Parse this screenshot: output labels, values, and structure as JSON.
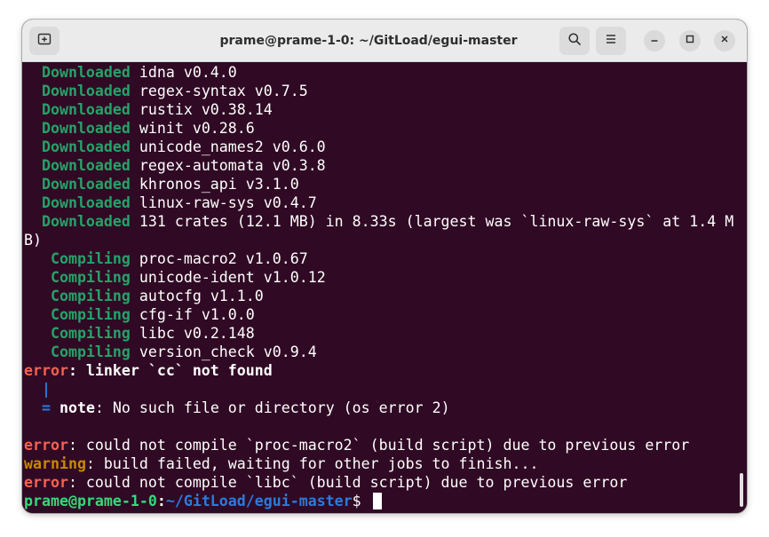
{
  "window": {
    "title": "prame@prame-1-0: ~/GitLoad/egui-master"
  },
  "icons": {
    "new_tab": "new-tab-icon",
    "search": "search-icon",
    "menu": "hamburger-menu-icon",
    "minimize": "minimize-icon",
    "maximize": "maximize-icon",
    "close": "close-icon"
  },
  "colors": {
    "terminal_bg": "#300a24",
    "green": "#26a269",
    "red": "#f66151",
    "yellow": "#c88800",
    "blue": "#2a7bde"
  },
  "terminal": {
    "lines": [
      {
        "parts": [
          {
            "t": "  "
          },
          {
            "t": "Downloaded",
            "c": "g"
          },
          {
            "t": " idna v0.4.0"
          }
        ]
      },
      {
        "parts": [
          {
            "t": "  "
          },
          {
            "t": "Downloaded",
            "c": "g"
          },
          {
            "t": " regex-syntax v0.7.5"
          }
        ]
      },
      {
        "parts": [
          {
            "t": "  "
          },
          {
            "t": "Downloaded",
            "c": "g"
          },
          {
            "t": " rustix v0.38.14"
          }
        ]
      },
      {
        "parts": [
          {
            "t": "  "
          },
          {
            "t": "Downloaded",
            "c": "g"
          },
          {
            "t": " winit v0.28.6"
          }
        ]
      },
      {
        "parts": [
          {
            "t": "  "
          },
          {
            "t": "Downloaded",
            "c": "g"
          },
          {
            "t": " unicode_names2 v0.6.0"
          }
        ]
      },
      {
        "parts": [
          {
            "t": "  "
          },
          {
            "t": "Downloaded",
            "c": "g"
          },
          {
            "t": " regex-automata v0.3.8"
          }
        ]
      },
      {
        "parts": [
          {
            "t": "  "
          },
          {
            "t": "Downloaded",
            "c": "g"
          },
          {
            "t": " khronos_api v3.1.0"
          }
        ]
      },
      {
        "parts": [
          {
            "t": "  "
          },
          {
            "t": "Downloaded",
            "c": "g"
          },
          {
            "t": " linux-raw-sys v0.4.7"
          }
        ]
      },
      {
        "parts": [
          {
            "t": "  "
          },
          {
            "t": "Downloaded",
            "c": "g"
          },
          {
            "t": " 131 crates (12.1 MB) in 8.33s (largest was `linux-raw-sys` at 1.4 M"
          }
        ]
      },
      {
        "parts": [
          {
            "t": "B)"
          }
        ]
      },
      {
        "parts": [
          {
            "t": "   "
          },
          {
            "t": "Compiling",
            "c": "g"
          },
          {
            "t": " proc-macro2 v1.0.67"
          }
        ]
      },
      {
        "parts": [
          {
            "t": "   "
          },
          {
            "t": "Compiling",
            "c": "g"
          },
          {
            "t": " unicode-ident v1.0.12"
          }
        ]
      },
      {
        "parts": [
          {
            "t": "   "
          },
          {
            "t": "Compiling",
            "c": "g"
          },
          {
            "t": " autocfg v1.1.0"
          }
        ]
      },
      {
        "parts": [
          {
            "t": "   "
          },
          {
            "t": "Compiling",
            "c": "g"
          },
          {
            "t": " cfg-if v1.0.0"
          }
        ]
      },
      {
        "parts": [
          {
            "t": "   "
          },
          {
            "t": "Compiling",
            "c": "g"
          },
          {
            "t": " libc v0.2.148"
          }
        ]
      },
      {
        "parts": [
          {
            "t": "   "
          },
          {
            "t": "Compiling",
            "c": "g"
          },
          {
            "t": " version_check v0.9.4"
          }
        ]
      },
      {
        "parts": [
          {
            "t": "error",
            "c": "r"
          },
          {
            "t": ": linker `cc` not found",
            "c": "w"
          }
        ]
      },
      {
        "parts": [
          {
            "t": "  "
          },
          {
            "t": "|",
            "c": "b"
          }
        ]
      },
      {
        "parts": [
          {
            "t": "  "
          },
          {
            "t": "=",
            "c": "b"
          },
          {
            "t": " "
          },
          {
            "t": "note",
            "c": "w"
          },
          {
            "t": ": No such file or directory (os error 2)"
          }
        ]
      },
      {
        "parts": []
      },
      {
        "parts": [
          {
            "t": "error",
            "c": "r"
          },
          {
            "t": ": could not compile `proc-macro2` (build script) due to previous error"
          }
        ]
      },
      {
        "parts": [
          {
            "t": "warning",
            "c": "y"
          },
          {
            "t": ": build failed, waiting for other jobs to finish..."
          }
        ]
      },
      {
        "parts": [
          {
            "t": "error",
            "c": "r"
          },
          {
            "t": ": could not compile `libc` (build script) due to previous error"
          }
        ]
      }
    ],
    "prompt": {
      "user_host": "prame@prame-1-0",
      "colon": ":",
      "path": "~/GitLoad/egui-master",
      "symbol": "$ "
    }
  }
}
